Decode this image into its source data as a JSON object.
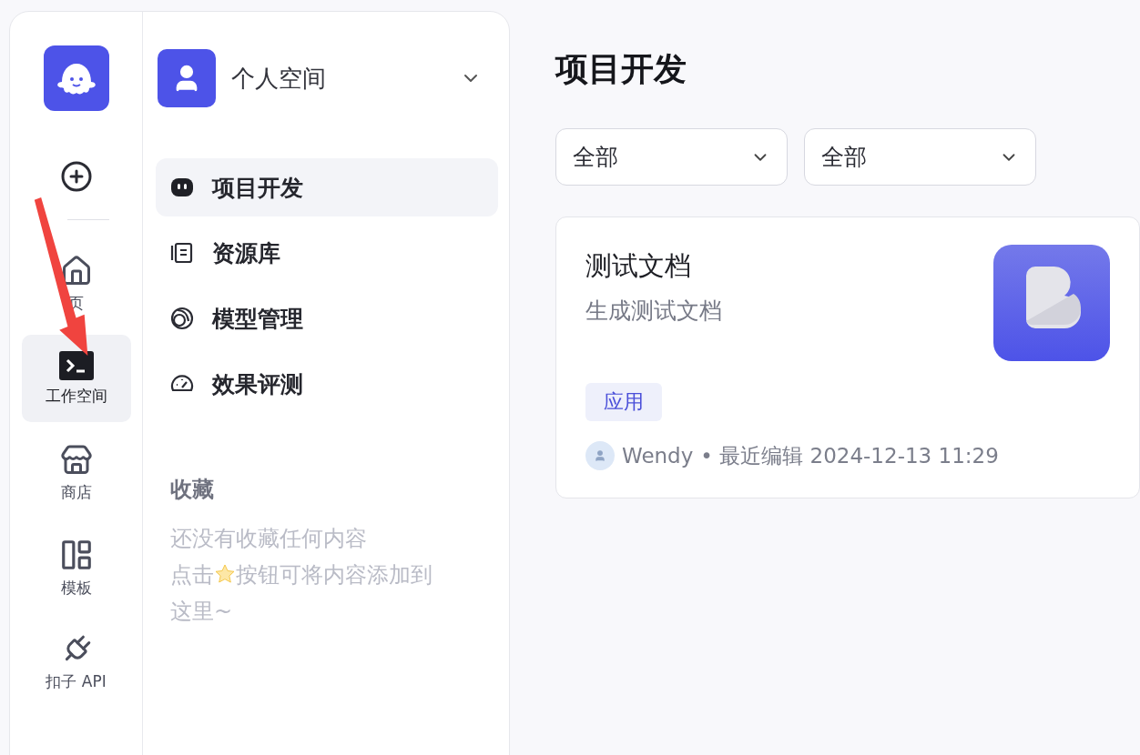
{
  "rail": {
    "items": [
      {
        "kind": "home",
        "label": "页",
        "selected": false
      },
      {
        "kind": "workspace",
        "label": "工作空间",
        "selected": true
      },
      {
        "kind": "store",
        "label": "商店",
        "selected": false
      },
      {
        "kind": "template",
        "label": "模板",
        "selected": false
      },
      {
        "kind": "api",
        "label": "扣子 API",
        "selected": false
      }
    ]
  },
  "sidebar": {
    "space": "个人空间",
    "items": [
      {
        "kind": "project",
        "label": "项目开发",
        "selected": true
      },
      {
        "kind": "library",
        "label": "资源库",
        "selected": false
      },
      {
        "kind": "model",
        "label": "模型管理",
        "selected": false
      },
      {
        "kind": "eval",
        "label": "效果评测",
        "selected": false
      }
    ],
    "favorites": {
      "title": "收藏",
      "empty": "还没有收藏任何内容",
      "hint_before": "点击",
      "hint_after": [
        "按钮可将内容添加到",
        "这里~"
      ]
    }
  },
  "main": {
    "title": "项目开发",
    "filters": [
      "全部",
      "全部"
    ],
    "cards": [
      {
        "title": "测试文档",
        "description": "生成测试文档",
        "tag": "应用",
        "author": "Wendy",
        "meta": "• 最近编辑 2024-12-13 11:29"
      }
    ]
  }
}
